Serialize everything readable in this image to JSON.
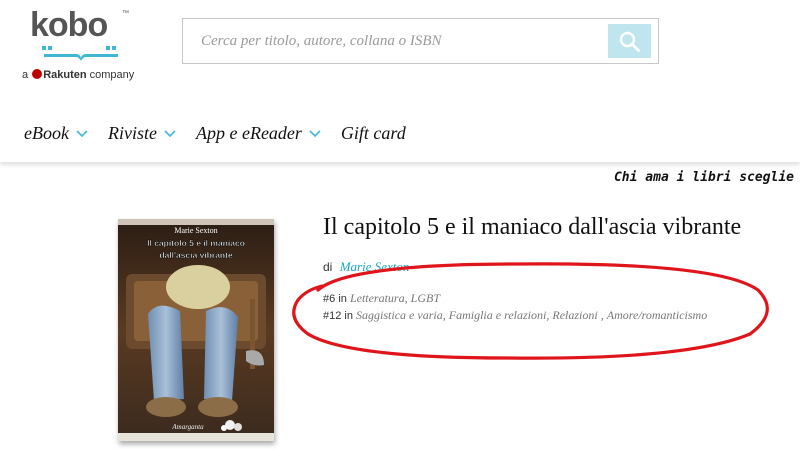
{
  "brand": {
    "logo_text": "kobo",
    "trademark": "™",
    "tagline_prefix": "a",
    "tagline_brand": "Rakuten",
    "tagline_suffix": "company",
    "colors": {
      "book_blue": "#3fb6d3",
      "rakuten_red": "#bf0000",
      "logo_gray": "#555555"
    }
  },
  "search": {
    "placeholder": "Cerca per titolo, autore, collana o ISBN",
    "icon": "search-icon"
  },
  "nav": {
    "items": [
      {
        "label": "eBook",
        "has_dropdown": true
      },
      {
        "label": "Riviste",
        "has_dropdown": true
      },
      {
        "label": "App e eReader",
        "has_dropdown": true
      },
      {
        "label": "Gift card",
        "has_dropdown": false
      }
    ]
  },
  "tagline": "Chi ama i libri sceglie",
  "book": {
    "title": "Il capitolo 5 e il maniaco dall'ascia vibrante",
    "by_prefix": "di",
    "author": "Marie Sexton",
    "cover": {
      "author": "Marie Sexton",
      "title_line1": "Il capitolo 5 e il maniaco",
      "title_line2": "dall'ascia vibrante",
      "publisher": "Amarganta"
    },
    "rankings": [
      {
        "rank": "#6",
        "in": "in",
        "categories": [
          "Letteratura",
          "LGBT"
        ]
      },
      {
        "rank": "#12",
        "in": "in",
        "categories": [
          "Saggistica e varia",
          "Famiglia e relazioni",
          "Relazioni ",
          "Amore/romanticismo"
        ]
      }
    ]
  },
  "annotation_color": "#e0151b"
}
